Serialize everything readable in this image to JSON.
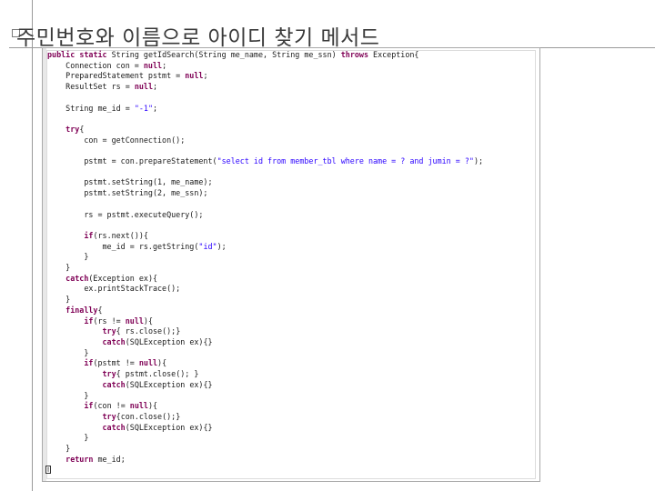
{
  "slide": {
    "title": "주민번호와 이름으로 아이디 찾기 메서드"
  },
  "code": {
    "lines": [
      "public static String getIdSearch(String me_name, String me_ssn) throws Exception{",
      "    Connection con = null;",
      "    PreparedStatement pstmt = null;",
      "    ResultSet rs = null;",
      "",
      "    String me_id = \"-1\";",
      "",
      "    try{",
      "        con = getConnection();",
      "",
      "        pstmt = con.prepareStatement(\"select id from member_tbl where name = ? and jumin = ?\");",
      "",
      "        pstmt.setString(1, me_name);",
      "        pstmt.setString(2, me_ssn);",
      "",
      "        rs = pstmt.executeQuery();",
      "",
      "        if(rs.next()){",
      "            me_id = rs.getString(\"id\");",
      "        }",
      "    }",
      "    catch(Exception ex){",
      "        ex.printStackTrace();",
      "    }",
      "    finally{",
      "        if(rs != null){",
      "            try{ rs.close();}",
      "            catch(SQLException ex){}",
      "        }",
      "        if(pstmt != null){",
      "            try{ pstmt.close(); }",
      "            catch(SQLException ex){}",
      "        }",
      "        if(con != null){",
      "            try{con.close();}",
      "            catch(SQLException ex){}",
      "        }",
      "    }",
      "    return me_id;"
    ],
    "keywords": [
      "public",
      "static",
      "throws",
      "null",
      "try",
      "catch",
      "finally",
      "if",
      "return"
    ]
  }
}
